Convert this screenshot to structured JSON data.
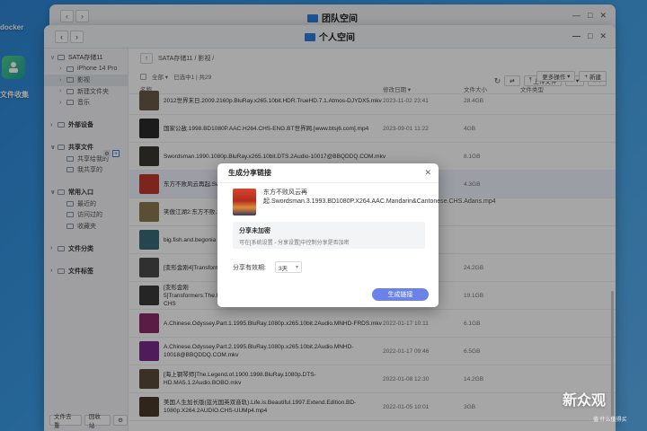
{
  "desktop": {
    "items": [
      {
        "label": "docker"
      },
      {
        "label": "文件收集"
      }
    ]
  },
  "back_window": {
    "title": "团队空间"
  },
  "window": {
    "title": "个人空间",
    "path": "SATA存储11 / 影视 /",
    "toolbar": {
      "more_label": "更多操作",
      "upload_label": "上传文件",
      "new_label": "新建"
    },
    "selection": {
      "all_label": "全部",
      "info": "已选中1 | 共29"
    },
    "columns": {
      "name": "名称",
      "modified": "修改日期",
      "size": "文件大小",
      "type": "文件类型"
    }
  },
  "sidebar": {
    "items": [
      {
        "label": "SATA存储11",
        "level": 0,
        "arrow": "∨"
      },
      {
        "label": "iPhone 14 Pro",
        "level": 1,
        "arrow": "›"
      },
      {
        "label": "影视",
        "level": 1,
        "arrow": "›",
        "selected": true
      },
      {
        "label": "新建文件夹",
        "level": 1,
        "arrow": "›"
      },
      {
        "label": "音乐",
        "level": 1,
        "arrow": "›"
      },
      {
        "label": "",
        "level": 0,
        "arrow": ""
      },
      {
        "label": "外部设备",
        "level": 0,
        "arrow": "›",
        "head": true
      },
      {
        "label": "",
        "level": 0,
        "arrow": ""
      },
      {
        "label": "共享文件",
        "level": 0,
        "arrow": "∨",
        "head": true
      },
      {
        "label": "共享给我的",
        "level": 1,
        "arrow": ""
      },
      {
        "label": "我共享的",
        "level": 1,
        "arrow": ""
      },
      {
        "label": "",
        "level": 0,
        "arrow": ""
      },
      {
        "label": "常用入口",
        "level": 0,
        "arrow": "∨",
        "head": true
      },
      {
        "label": "最近的",
        "level": 1,
        "arrow": ""
      },
      {
        "label": "访问过的",
        "level": 1,
        "arrow": ""
      },
      {
        "label": "收藏夹",
        "level": 1,
        "arrow": ""
      },
      {
        "label": "",
        "level": 0,
        "arrow": ""
      },
      {
        "label": "文件分类",
        "level": 0,
        "arrow": "›",
        "head": true
      },
      {
        "label": "",
        "level": 0,
        "arrow": ""
      },
      {
        "label": "文件标签",
        "level": 0,
        "arrow": "›",
        "head": true
      }
    ],
    "bottom": {
      "filter_label": "文件去重",
      "trash_label": "回收站"
    }
  },
  "files": [
    {
      "name": "2012世界末日.2009.2160p.BluRay.x265.10bit.HDR.TrueHD.7.1.Atmos-DJYDX5.mkv",
      "date": "2023-11-02 23:41",
      "size": "28.4GB",
      "color": "#6a5a48"
    },
    {
      "name": "国家公敌.1998.BD1080P.AAC.H264.CHS-ENG.BT世界网.[www.btsj6.com].mp4",
      "date": "2023-09-01 11:22",
      "size": "4GB",
      "color": "#2a2a2a"
    },
    {
      "name": "Swordsman.1990.1080p.BluRay.x265.10bit.DTS.2Audio-10017@BBQDDQ.COM.mkv",
      "date": "",
      "size": "8.1GB",
      "color": "#3a3630"
    },
    {
      "name": "东方不败风云再起.Swordsman.3.1993.BD1080P.x264",
      "date": "",
      "size": "4.3GB",
      "color": "#c0392b"
    },
    {
      "name": "笑傲江湖2:东方不败.Swordsman.2.1992",
      "date": "",
      "size": "",
      "color": "#8a7a50"
    },
    {
      "name": "big.fish.and.begonia",
      "date": "",
      "size": "",
      "color": "#3a6a7a"
    },
    {
      "name": "[变形金刚4]Transformers.Age.of.Extinction",
      "date": "",
      "size": "24.2GB",
      "color": "#4a4a4a"
    },
    {
      "name": "[变形金刚5]Transformers.The.Last.Knight.2017.2160p.UHD.BluRay.x265.10bit.HDR.TrueHD.7.1.Atmos-CHS",
      "date": "",
      "size": "19.1GB",
      "color": "#3a3a3a"
    },
    {
      "name": "A.Chinese.Odyssey.Part.1.1995.BluRay.1080p.x265.10bit.2Audio.MNHD-FRDS.mkv",
      "date": "2022-01-17 10:11",
      "size": "6.1GB",
      "color": "#8a2a6a"
    },
    {
      "name": "A.Chinese.Odyssey.Part.2.1995.BluRay.1080p.x265.10bit.2Audio.MNHD-10018@BBQDDQ.COM.mkv",
      "date": "2022-01-17 09:46",
      "size": "6.5GB",
      "color": "#7a2a8a"
    },
    {
      "name": "[海上钢琴师]The.Legend.of.1900.1998.BluRay.1080p.DTS-HD.MA5.1.2Audio.BOBO.mkv",
      "date": "2022-01-08 12:30",
      "size": "14.2GB",
      "color": "#5a4a3a"
    },
    {
      "name": "美国人生加长版(蓝光国英双音轨).Life.is.Beautiful.1997.Extend.Edition.BD-1080p.X264.2AUDIO.CHS-UUMp4.mp4",
      "date": "2022-01-05 10:01",
      "size": "3GB",
      "color": "#4a3a2a"
    }
  ],
  "dialog": {
    "title": "生成分享链接",
    "file_name": "东方不败风云再起.Swordsman.3.1993.BD1080P.X264.AAC.Mandarin&Cantonese.CHS.Adans.mp4",
    "notice_title": "分享未加密",
    "notice_desc": "可在[系统设置 - 分享设置]中控制分享是否加密",
    "validity_label": "分享有效期:",
    "validity_value": "3天",
    "submit_label": "生成链接"
  },
  "watermark": {
    "text": "新众观",
    "sub": "值 什么值得买"
  }
}
